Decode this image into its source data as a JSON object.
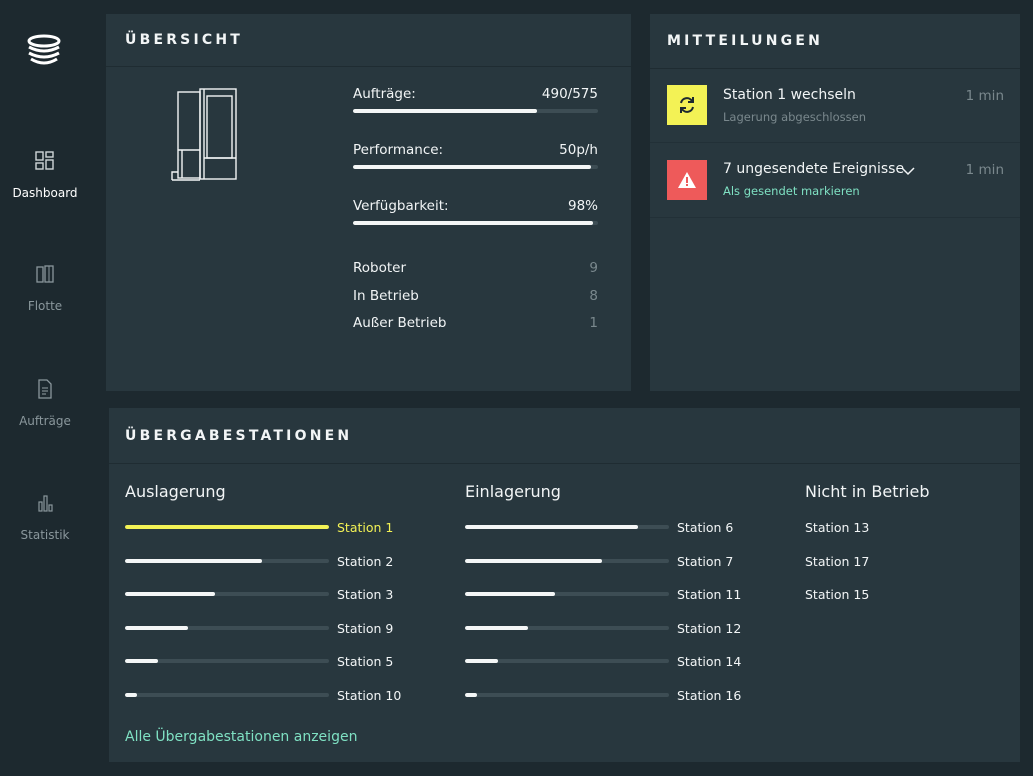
{
  "colors": {
    "background": "#1d292f",
    "card": "#28373e",
    "accent_yellow": "#f3f255",
    "accent_red": "#ee5a5a",
    "link_green": "#7fe1c3"
  },
  "sidebar": {
    "items": [
      {
        "icon": "dashboard-grid-icon",
        "label": "Dashboard",
        "active": true
      },
      {
        "icon": "fleet-icon",
        "label": "Flotte",
        "active": false
      },
      {
        "icon": "document-icon",
        "label": "Aufträge",
        "active": false
      },
      {
        "icon": "bar-chart-icon",
        "label": "Statistik",
        "active": false
      }
    ]
  },
  "overview": {
    "title": "ÜBERSICHT",
    "metrics": [
      {
        "label": "Aufträge:",
        "value": "490/575",
        "fraction": 0.75
      },
      {
        "label": "Performance:",
        "value": "50p/h",
        "fraction": 0.97
      },
      {
        "label": "Verfügbarkeit:",
        "value": "98%",
        "fraction": 0.98
      }
    ],
    "stats": [
      {
        "label": "Roboter",
        "value": "9"
      },
      {
        "label": "In Betrieb",
        "value": "8"
      },
      {
        "label": "Außer Betrieb",
        "value": "1"
      }
    ]
  },
  "messages": {
    "title": "MITTEILUNGEN",
    "items": [
      {
        "icon": "sync-icon",
        "title": "Station 1 wechseln",
        "subtitle": "Lagerung abgeschlossen",
        "time": "1 min"
      },
      {
        "icon": "warning-icon",
        "title": "7 ungesendete Ereignisse",
        "subtitle": "Als gesendet markieren",
        "time": "1 min"
      }
    ]
  },
  "stations": {
    "title": "ÜBERGABESTATIONEN",
    "auslagerung": {
      "title": "Auslagerung",
      "items": [
        {
          "name": "Station 1",
          "fraction": 1.0
        },
        {
          "name": "Station 2",
          "fraction": 0.67
        },
        {
          "name": "Station 3",
          "fraction": 0.44
        },
        {
          "name": "Station 9",
          "fraction": 0.31
        },
        {
          "name": "Station 5",
          "fraction": 0.16
        },
        {
          "name": "Station 10",
          "fraction": 0.06
        }
      ]
    },
    "einlagerung": {
      "title": "Einlagerung",
      "items": [
        {
          "name": "Station 6",
          "fraction": 0.85
        },
        {
          "name": "Station 7",
          "fraction": 0.67
        },
        {
          "name": "Station 11",
          "fraction": 0.44
        },
        {
          "name": "Station 12",
          "fraction": 0.31
        },
        {
          "name": "Station 14",
          "fraction": 0.16
        },
        {
          "name": "Station 16",
          "fraction": 0.06
        }
      ]
    },
    "nicht_in_betrieb": {
      "title": "Nicht in Betrieb",
      "items": [
        {
          "name": "Station 13"
        },
        {
          "name": "Station 17"
        },
        {
          "name": "Station 15"
        }
      ]
    },
    "show_all_link": "Alle Übergabestationen anzeigen"
  }
}
